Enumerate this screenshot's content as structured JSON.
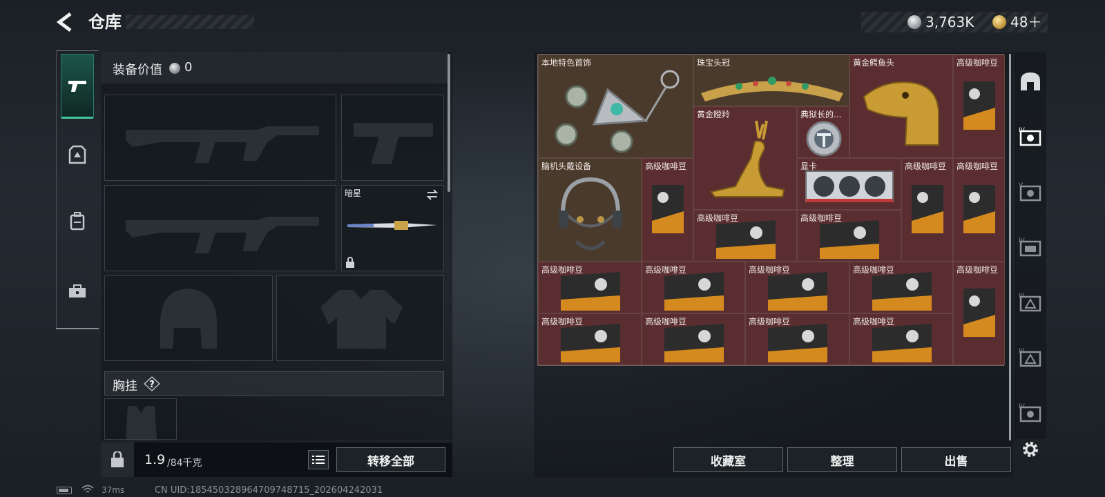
{
  "header": {
    "title": "仓库"
  },
  "currency": {
    "silver": "3,763K",
    "gold": "48＋"
  },
  "equipment": {
    "label": "装备价值",
    "value": "0"
  },
  "loadout": {
    "melee_name": "暗星",
    "chest_label": "胸挂"
  },
  "weight": {
    "current": "1.9",
    "max": "/84千克"
  },
  "buttons": {
    "transfer_all": "转移全部",
    "collection": "收藏室",
    "sort": "整理",
    "sell": "出售"
  },
  "status": {
    "ping": "37ms",
    "uid": "CN UID:18545032896470974​8715_202604242031"
  },
  "stash_items": {
    "ornament": "本地特色首饰",
    "crown": "珠宝头冠",
    "croc": "黄金鳄鱼头",
    "antelope": "黄金瞪羚",
    "warden": "典狱长的...",
    "headset": "脑机头戴设备",
    "gpu": "显卡",
    "coffee": "高级咖啡豆"
  },
  "icons": [
    "back-icon",
    "pistol-icon",
    "armor-icon",
    "backpack-icon",
    "toolbox-icon",
    "swap-icon",
    "lock-icon",
    "help-icon",
    "list-icon",
    "gear-icon",
    "helmet-filter-icon",
    "filter-tier-iv-icon",
    "filter-tier-v-icon"
  ],
  "colors": {
    "accent": "#45c6a0",
    "stash_cell": "#5a2e30",
    "stash_brown": "#4a3a2b"
  }
}
